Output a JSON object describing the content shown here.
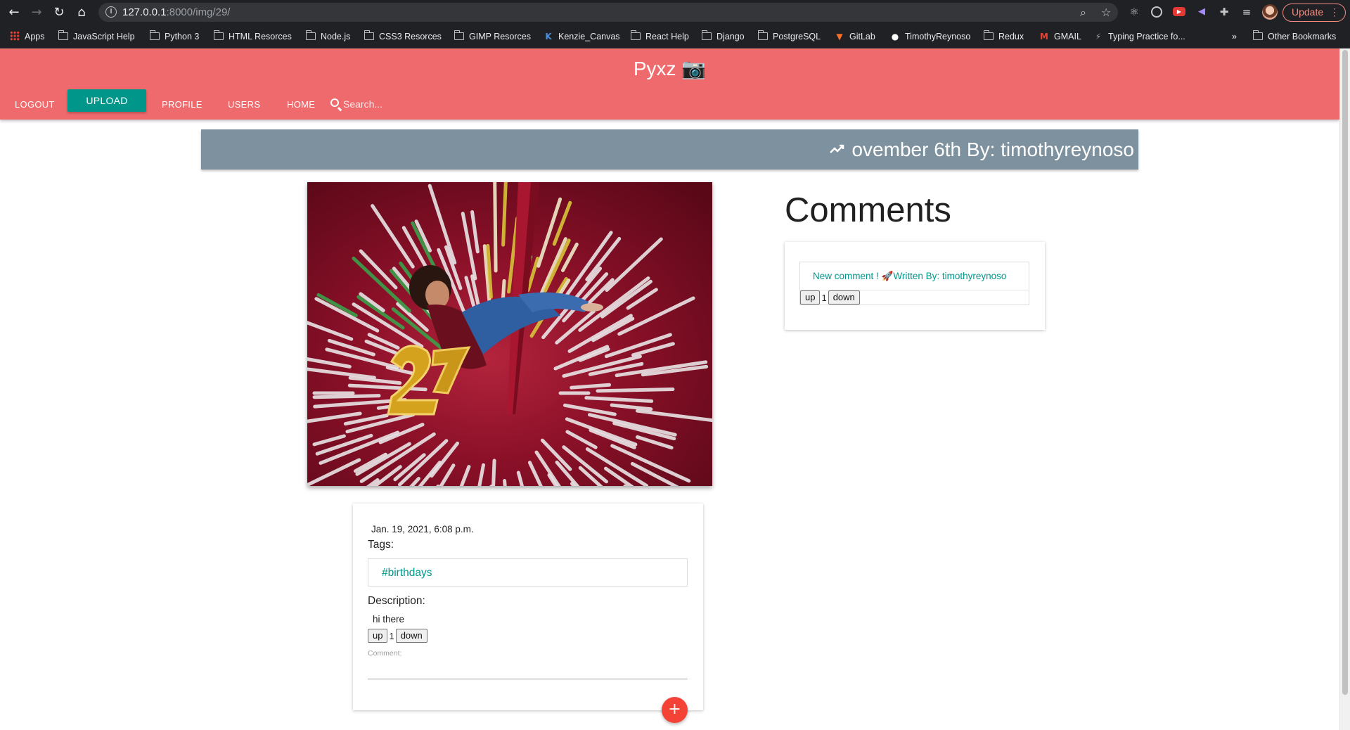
{
  "browser": {
    "url_host": "127.0.0.1",
    "url_rest": ":8000/img/29/",
    "update_label": "Update",
    "bookmarks": [
      {
        "label": "Apps",
        "icon": "apps-grid-icon"
      },
      {
        "label": "JavaScript Help",
        "icon": "folder-icon"
      },
      {
        "label": "Python 3",
        "icon": "folder-icon"
      },
      {
        "label": "HTML Resorces",
        "icon": "folder-icon"
      },
      {
        "label": "Node.js",
        "icon": "folder-icon"
      },
      {
        "label": "CSS3 Resorces",
        "icon": "folder-icon"
      },
      {
        "label": "GIMP Resorces",
        "icon": "folder-icon"
      },
      {
        "label": "Kenzie_Canvas",
        "icon": "kenzie-icon"
      },
      {
        "label": "React Help",
        "icon": "folder-icon"
      },
      {
        "label": "Django",
        "icon": "folder-icon"
      },
      {
        "label": "PostgreSQL",
        "icon": "folder-icon"
      },
      {
        "label": "GitLab",
        "icon": "gitlab-icon"
      },
      {
        "label": "TimothyReynoso",
        "icon": "github-icon"
      },
      {
        "label": "Redux",
        "icon": "folder-icon"
      },
      {
        "label": "GMAIL",
        "icon": "gmail-icon"
      },
      {
        "label": "Typing Practice fo...",
        "icon": "bolt-icon"
      }
    ],
    "overflow_label": "»",
    "other_bookmarks": "Other Bookmarks"
  },
  "header": {
    "brand": "Pyxz 📷",
    "nav": {
      "logout": "LOGOUT",
      "upload": "UPLOAD",
      "profile": "PROFILE",
      "users": "USERS",
      "home": "HOME"
    },
    "search_placeholder": "Search..."
  },
  "post": {
    "title": "ovember 6th By: timothyreynoso",
    "date": "Jan. 19, 2021, 6:08 p.m.",
    "tags_label": "Tags:",
    "tags": [
      "#birthdays"
    ],
    "description_label": "Description:",
    "description": "hi there",
    "vote": {
      "up": "up",
      "count": "1",
      "down": "down"
    },
    "comment_label": "Comment:",
    "add_icon": "plus-icon"
  },
  "comments": {
    "title": "Comments",
    "items": [
      {
        "text": "New comment ! 🚀Written By: timothyreynoso",
        "vote": {
          "up": "up",
          "count": "1",
          "down": "down"
        }
      }
    ]
  },
  "colors": {
    "header": "#ef6a6c",
    "accent": "#00978a",
    "title_bar": "#7e919f",
    "fab": "#f44336"
  }
}
